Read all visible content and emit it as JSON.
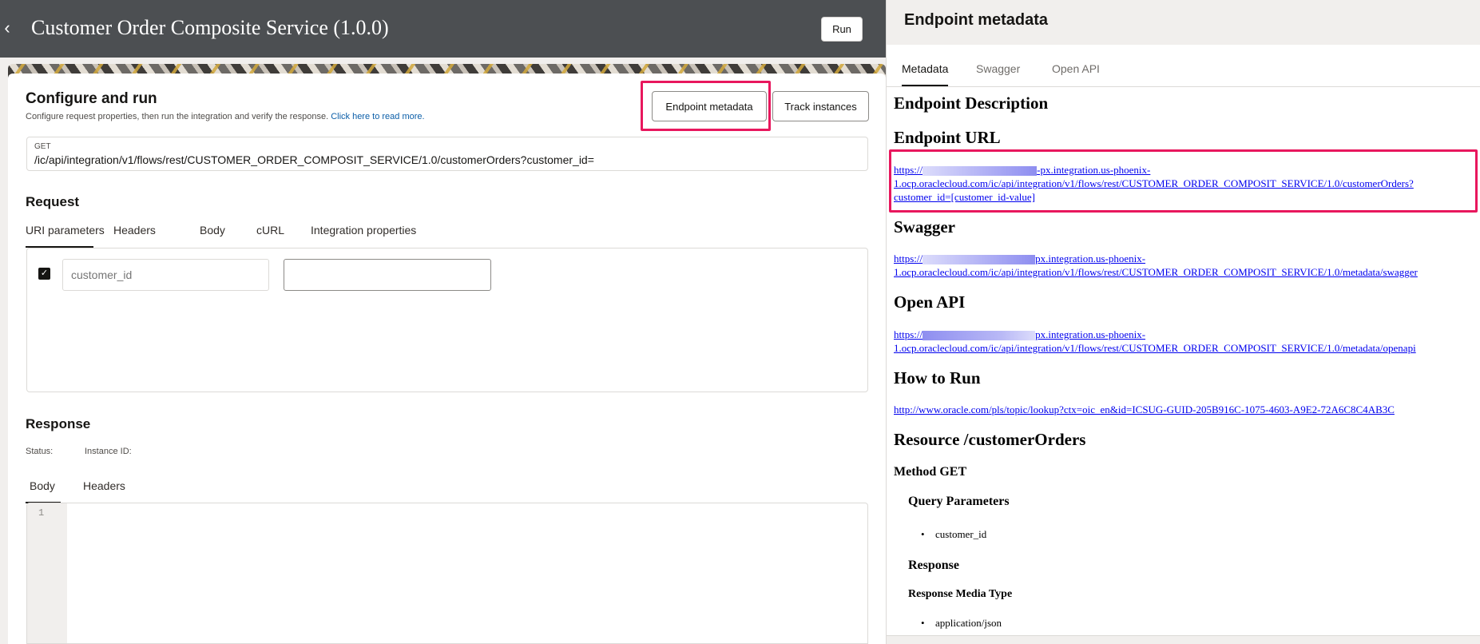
{
  "header": {
    "back_icon": "chevron-left-icon",
    "title": "Customer Order Composite Service (1.0.0)",
    "run_label": "Run"
  },
  "configure": {
    "title": "Configure and run",
    "subtitle": "Configure request properties, then run the integration and verify the response.",
    "link": "Click here to read more.",
    "endpoint_button": "Endpoint metadata",
    "track_button": "Track instances",
    "highlight_color": "#e8175d"
  },
  "url_field": {
    "method": "GET",
    "path": "/ic/api/integration/v1/flows/rest/CUSTOMER_ORDER_COMPOSIT_SERVICE/1.0/customerOrders?customer_id="
  },
  "request": {
    "title": "Request",
    "tabs": [
      {
        "label": "URI parameters",
        "active": true
      },
      {
        "label": "Headers",
        "active": false
      },
      {
        "label": "Body",
        "active": false
      },
      {
        "label": "cURL",
        "active": false
      },
      {
        "label": "Integration properties",
        "active": false
      }
    ],
    "param": {
      "checked": true,
      "name_placeholder": "customer_id",
      "value": ""
    }
  },
  "response": {
    "title": "Response",
    "status_label": "Status:",
    "instance_label": "Instance ID:",
    "tabs": [
      {
        "label": "Body",
        "active": true
      },
      {
        "label": "Headers",
        "active": false
      }
    ],
    "line_number": "1"
  },
  "metadata_panel": {
    "title": "Endpoint metadata",
    "tabs": [
      {
        "label": "Metadata",
        "active": true
      },
      {
        "label": "Swagger",
        "active": false
      },
      {
        "label": "Open API",
        "active": false
      }
    ],
    "endpoint_description_heading": "Endpoint Description",
    "endpoint_url_heading": "Endpoint URL",
    "endpoint_url": {
      "line1_prefix": "https://",
      "line1_suffix": "-px.integration.us-phoenix-",
      "line2": "1.ocp.oraclecloud.com/ic/api/integration/v1/flows/rest/CUSTOMER_ORDER_COMPOSIT_SERVICE/1.0/customerOrders?",
      "line3": "customer_id=[customer_id-value]"
    },
    "swagger_heading": "Swagger",
    "swagger_url": {
      "line1_prefix": "https://",
      "line1_suffix": "px.integration.us-phoenix-",
      "line2": "1.ocp.oraclecloud.com/ic/api/integration/v1/flows/rest/CUSTOMER_ORDER_COMPOSIT_SERVICE/1.0/metadata/swagger"
    },
    "openapi_heading": "Open API",
    "openapi_url": {
      "line1_prefix": "https://",
      "line1_suffix": "px.integration.us-phoenix-",
      "line2": "1.ocp.oraclecloud.com/ic/api/integration/v1/flows/rest/CUSTOMER_ORDER_COMPOSIT_SERVICE/1.0/metadata/openapi"
    },
    "how_to_run_heading": "How to Run",
    "how_to_run_url": "http://www.oracle.com/pls/topic/lookup?ctx=oic_en&id=ICSUG-GUID-205B916C-1075-4603-A9E2-72A6C8C4AB3C",
    "resource_heading": "Resource /customerOrders",
    "method_heading": "Method GET",
    "query_params_heading": "Query Parameters",
    "query_params": [
      "customer_id"
    ],
    "response_heading": "Response",
    "media_type_heading": "Response Media Type",
    "media_types": [
      "application/json"
    ]
  }
}
